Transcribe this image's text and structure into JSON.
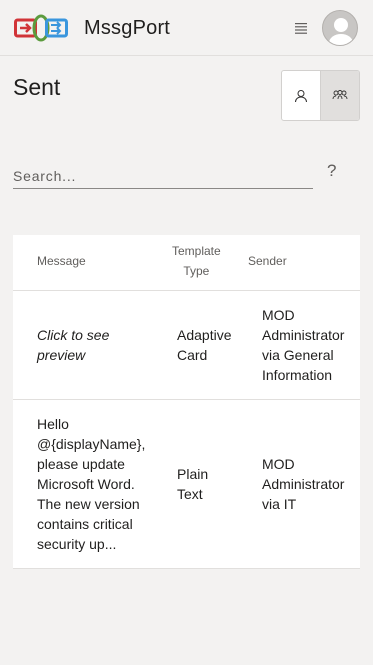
{
  "header": {
    "app_name": "MssgPort",
    "logo_icon": "mssgport-logo-icon",
    "menu_icon": "hamburger-menu-icon",
    "avatar_icon": "user-avatar-icon"
  },
  "page": {
    "title": "Sent"
  },
  "view_toggle": {
    "left_icon": "person-icon",
    "right_icon": "people-group-icon",
    "selected": "right"
  },
  "search": {
    "placeholder": "Search...",
    "value": "",
    "help_label": "?"
  },
  "table": {
    "columns": [
      "Message",
      "Template\nType",
      "Sender"
    ],
    "rows": [
      {
        "message": "Click to see\npreview",
        "message_style": "italic",
        "template_type": "Adaptive\nCard",
        "sender": "MOD\nAdministrator\nvia General\nInformation"
      },
      {
        "message": "Hello\n@{displayName},\nplease update\nMicrosoft Word.\nThe new version\ncontains critical\nsecurity up...",
        "message_style": "normal",
        "template_type": "Plain\nText",
        "sender": "MOD\nAdministrator\nvia IT"
      }
    ]
  },
  "colors": {
    "background": "#f3f2f1",
    "surface": "#ffffff",
    "border": "#e1dfdd",
    "text_primary": "#201f1e",
    "text_secondary": "#605e5c",
    "logo_red": "#d13438",
    "logo_green": "#5c9b3e",
    "logo_blue": "#3a96dd"
  }
}
